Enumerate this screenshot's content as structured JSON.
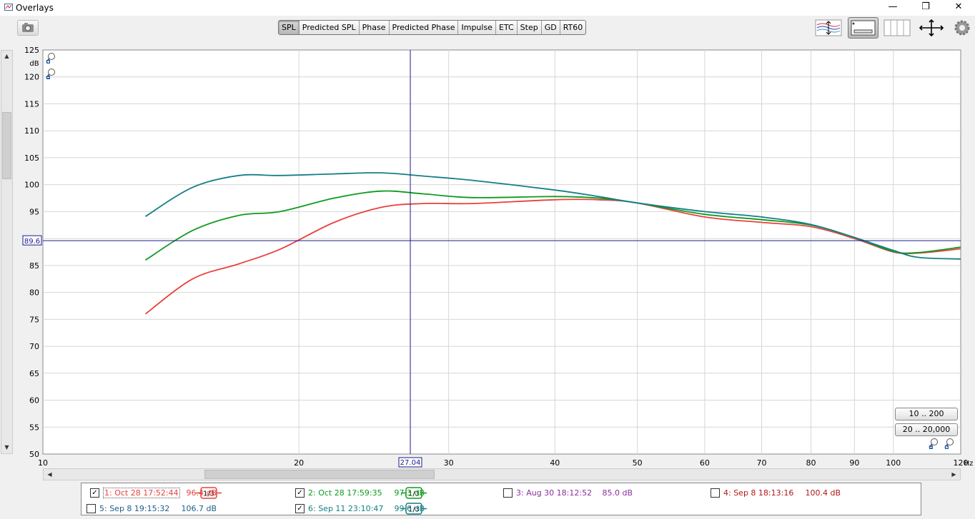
{
  "window": {
    "title": "Overlays",
    "controls": {
      "minimize": "—",
      "maximize": "❐",
      "close": "✕"
    }
  },
  "toolbar": {
    "tabs": [
      "SPL",
      "Predicted SPL",
      "Phase",
      "Predicted Phase",
      "Impulse",
      "ETC",
      "Step",
      "GD",
      "RT60"
    ],
    "active_tab": "SPL",
    "icons": [
      "camera-icon",
      "separate-traces-icon",
      "trace-panel-icon",
      "grid-icon",
      "fit-all-icon",
      "settings-icon"
    ]
  },
  "plot": {
    "y_unit": "dB",
    "x_unit": "Hz",
    "cursor_x_label": "27.04",
    "cursor_y_label": "89.6",
    "range_buttons": [
      "10 .. 200",
      "20 .. 20,000"
    ]
  },
  "chart_data": {
    "type": "line",
    "x_scale": "log",
    "xlim": [
      10,
      120
    ],
    "ylim": [
      50,
      125
    ],
    "x_ticks": [
      "10",
      "20",
      "30",
      "40",
      "50",
      "60",
      "70",
      "80",
      "90",
      "100",
      "120"
    ],
    "y_ticks": [
      "50",
      "55",
      "60",
      "65",
      "70",
      "75",
      "80",
      "85",
      "90",
      "95",
      "100",
      "105",
      "110",
      "115",
      "120",
      "125"
    ],
    "grid": true,
    "cursor": {
      "x": 27.04,
      "y": 89.6
    },
    "series": [
      {
        "color": "#e8413c",
        "points": [
          [
            13.2,
            76
          ],
          [
            15,
            82.5
          ],
          [
            17,
            85.3
          ],
          [
            19,
            88
          ],
          [
            22,
            93
          ],
          [
            25,
            95.8
          ],
          [
            28,
            96.5
          ],
          [
            32,
            96.5
          ],
          [
            40,
            97.2
          ],
          [
            45,
            97.2
          ],
          [
            50,
            96.6
          ],
          [
            60,
            94
          ],
          [
            70,
            93
          ],
          [
            80,
            92.2
          ],
          [
            90,
            90
          ],
          [
            100,
            87.5
          ],
          [
            107,
            87.3
          ],
          [
            120,
            88.1
          ]
        ]
      },
      {
        "color": "#0e9a1e",
        "points": [
          [
            13.2,
            86
          ],
          [
            15,
            91.5
          ],
          [
            17,
            94.3
          ],
          [
            19,
            95
          ],
          [
            22,
            97.5
          ],
          [
            25,
            98.8
          ],
          [
            28,
            98.3
          ],
          [
            32,
            97.6
          ],
          [
            40,
            97.8
          ],
          [
            45,
            97.5
          ],
          [
            50,
            96.6
          ],
          [
            60,
            94.5
          ],
          [
            70,
            93.5
          ],
          [
            80,
            92.5
          ],
          [
            90,
            90.2
          ],
          [
            100,
            87.6
          ],
          [
            107,
            87.4
          ],
          [
            120,
            88.4
          ]
        ]
      },
      {
        "color": "#147f86",
        "points": [
          [
            13.2,
            94.1
          ],
          [
            15,
            99.5
          ],
          [
            17,
            101.7
          ],
          [
            19,
            101.7
          ],
          [
            22,
            102
          ],
          [
            25,
            102.2
          ],
          [
            28,
            101.6
          ],
          [
            32,
            100.8
          ],
          [
            40,
            99
          ],
          [
            45,
            97.8
          ],
          [
            50,
            96.6
          ],
          [
            60,
            95
          ],
          [
            70,
            94
          ],
          [
            80,
            92.6
          ],
          [
            90,
            90.2
          ],
          [
            100,
            87.8
          ],
          [
            107,
            86.5
          ],
          [
            120,
            86.2
          ]
        ]
      }
    ]
  },
  "legend": {
    "items": [
      {
        "checked": true,
        "label": "1: Oct 28 17:52:44",
        "smoothing": "1/3",
        "value": "96.4 dB",
        "color": "#e8413c",
        "selected": true
      },
      {
        "checked": true,
        "label": "2: Oct 28 17:59:35",
        "smoothing": "1/3",
        "value": "97.3 dB",
        "color": "#0e9a1e"
      },
      {
        "checked": false,
        "label": "3: Aug 30 18:12:52",
        "value": "85.0 dB",
        "color": "#8b2ea0"
      },
      {
        "checked": false,
        "label": "4: Sep 8 18:13:16",
        "value": "100.4 dB",
        "color": "#b01818"
      },
      {
        "checked": false,
        "label": "5: Sep 8 19:15:32",
        "value": "106.7 dB",
        "color": "#1c5e8a"
      },
      {
        "checked": true,
        "label": "6: Sep 11 23:10:47",
        "smoothing": "1/3",
        "value": "99.6 dB",
        "color": "#147f86"
      }
    ]
  }
}
